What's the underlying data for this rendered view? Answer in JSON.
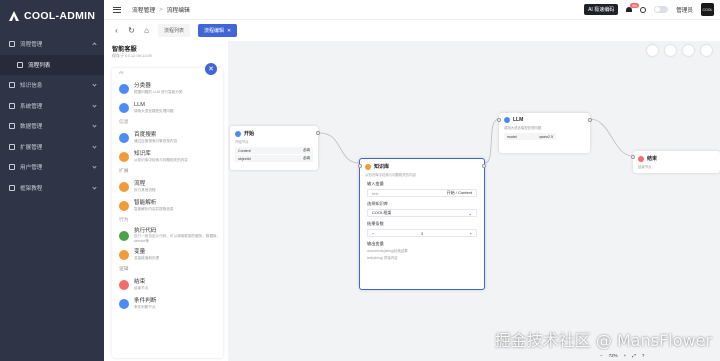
{
  "app": {
    "name": "COOL-ADMIN"
  },
  "sidebar": {
    "items": [
      {
        "label": "流程管理",
        "open": true
      },
      {
        "label": "流程列表",
        "sub": true
      },
      {
        "label": "知识信息"
      },
      {
        "label": "系统管理"
      },
      {
        "label": "数据管理"
      },
      {
        "label": "扩展管理"
      },
      {
        "label": "用户管理"
      },
      {
        "label": "框架教程"
      }
    ]
  },
  "topbar": {
    "breadcrumb": [
      "流程管理",
      "流程编辑"
    ],
    "ai_badge": "AI 极速编码",
    "notify_count": "99",
    "user": "管理员",
    "avatar_text": "COOL"
  },
  "tabs": [
    {
      "label": "流程列表",
      "active": false
    },
    {
      "label": "流程编辑",
      "active": true
    }
  ],
  "panel": {
    "title": "智能客服",
    "subtitle": "保存于 07-12 09:11:05",
    "groups": [
      {
        "name": "AI",
        "items": [
          {
            "title": "分类器",
            "desc": "根据问题的 LLM 进行智能分类",
            "color": "#4c8bf5",
            "icon": "classifier-icon"
          },
          {
            "title": "LLM",
            "desc": "调用大语言模型处理问题",
            "color": "#4c8bf5",
            "icon": "llm-icon"
          }
        ]
      },
      {
        "name": "信息",
        "items": [
          {
            "title": "百度搜索",
            "desc": "通过百度搜索引擎查找内容",
            "color": "#4c8bf5",
            "icon": "search-icon"
          },
          {
            "title": "知识库",
            "desc": "从知识库中检索与问题相关的内容",
            "color": "#f29a38",
            "icon": "knowledge-icon"
          }
        ]
      },
      {
        "name": "扩展",
        "items": [
          {
            "title": "流程",
            "desc": "执行其他流程",
            "color": "#f29a38",
            "icon": "flow-icon"
          },
          {
            "title": "智能解析",
            "desc": "智能解析内容并提取信息",
            "color": "#f29a38",
            "icon": "parse-icon"
          }
        ]
      },
      {
        "name": "行为",
        "items": [
          {
            "title": "执行代码",
            "desc": "执行一段自定义代码，可以调用框架的服务，数据库、service等",
            "color": "#4aa34a",
            "icon": "code-icon"
          },
          {
            "title": "变量",
            "desc": "变量赋值和处理",
            "color": "#f29a38",
            "icon": "variable-icon"
          }
        ]
      },
      {
        "name": "逻辑",
        "items": [
          {
            "title": "结束",
            "desc": "结束节点",
            "color": "#f56c6c",
            "icon": "end-icon"
          },
          {
            "title": "条件判断",
            "desc": "条件判断节点",
            "color": "#4c8bf5",
            "icon": "condition-icon"
          }
        ]
      }
    ]
  },
  "canvas": {
    "start": {
      "title": "开始",
      "desc": "开始节点",
      "rows": [
        {
          "k": "Content",
          "v": "必填"
        },
        {
          "k": "objectId",
          "v": "必填"
        }
      ]
    },
    "knowledge": {
      "title": "知识库",
      "desc": "从知识库中检索与问题相关的内容",
      "input_label": "输入变量",
      "input_name": "text",
      "input_value": "开始 / Content",
      "select_label": "选择知识库",
      "select_value": "COOL框架",
      "count_label": "结果条数",
      "count_value": "3",
      "output_label": "输出变量",
      "outputs": [
        "documents(string)检索结果",
        "text(string) 拼接内容"
      ]
    },
    "llm": {
      "title": "LLM",
      "desc": "调用大语言模型处理问题",
      "row_k": "model",
      "row_v": "qwen2.5"
    },
    "end": {
      "title": "结束",
      "desc": "结束节点"
    },
    "zoom": "72%",
    "watermark": "掘金技术社区 @ MansFlower"
  },
  "colors": {
    "accent": "#4165d7",
    "sidebar": "#2f3447"
  }
}
